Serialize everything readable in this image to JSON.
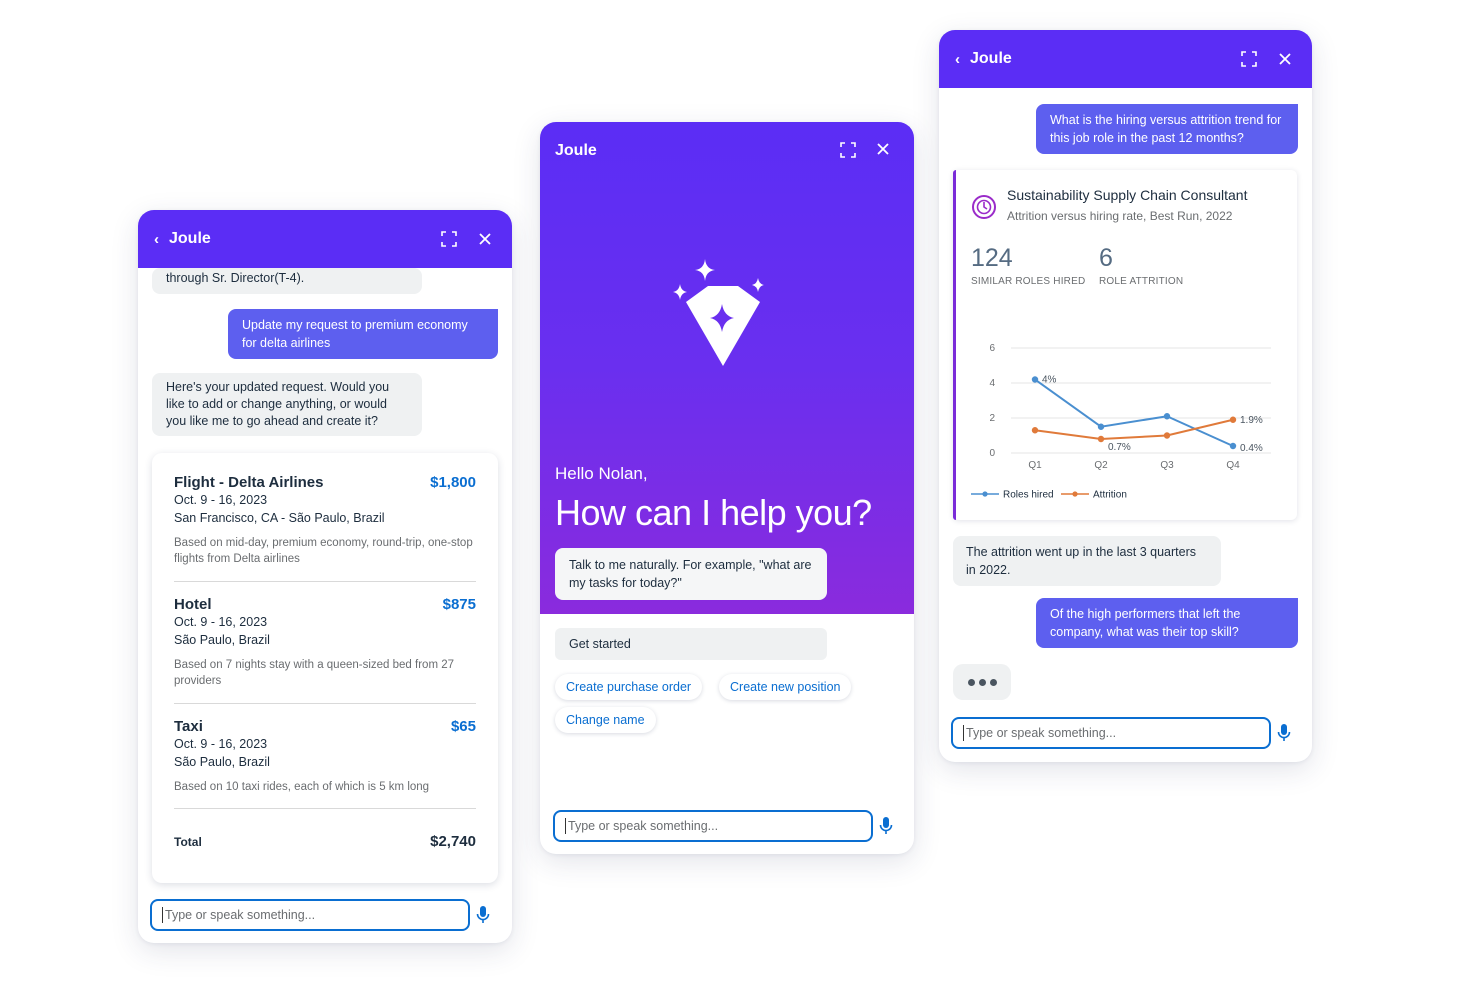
{
  "p1": {
    "title": "Joule",
    "msg_partial": "through Sr. Director(T-4).",
    "user_msg": "Update my request to premium economy for delta airlines",
    "bot_msg": "Here's your updated request. Would you like to add or change anything, or would you like me to go ahead and create it?",
    "items": [
      {
        "name": "Flight - Delta Airlines",
        "price": "$1,800",
        "dates": "Oct. 9 - 16, 2023",
        "place": "San Francisco, CA - São Paulo, Brazil",
        "note": "Based on mid-day, premium economy, round-trip, one-stop flights from Delta airlines"
      },
      {
        "name": "Hotel",
        "price": "$875",
        "dates": "Oct. 9 - 16, 2023",
        "place": "São Paulo, Brazil",
        "note": "Based on 7 nights stay with a queen-sized bed from 27 providers"
      },
      {
        "name": "Taxi",
        "price": "$65",
        "dates": "Oct. 9 - 16, 2023",
        "place": "São Paulo, Brazil",
        "note": "Based on 10 taxi rides, each of which is 5 km long"
      }
    ],
    "total_label": "Total",
    "total_value": "$2,740",
    "input_placeholder": "Type or speak something..."
  },
  "p2": {
    "title": "Joule",
    "hello": "Hello Nolan,",
    "headline": "How can I help you?",
    "prompt": "Talk to me naturally. For example, \"what are my tasks for today?\"",
    "get_started": "Get started",
    "chips": [
      "Create purchase order",
      "Create new position",
      "Change name"
    ],
    "input_placeholder": "Type or speak something..."
  },
  "p3": {
    "title": "Joule",
    "user_msg1": "What is the hiring versus attrition trend for this job role in the past 12 months?",
    "card_title": "Sustainability Supply Chain Consultant",
    "card_subtitle": "Attrition versus hiring rate, Best Run, 2022",
    "kpi1_value": "124",
    "kpi1_label": "SIMILAR ROLES HIRED",
    "kpi2_value": "6",
    "kpi2_label": "ROLE ATTRITION",
    "bot_msg": "The attrition went up in the last 3 quarters in 2022.",
    "user_msg2": "Of the high performers that left the company, what was their top skill?",
    "input_placeholder": "Type or speak something..."
  },
  "colors": {
    "brand": "#5b2df5",
    "accent_link": "#0a6ed1",
    "roles_hired": "#4a8fd0",
    "attrition": "#e07a3a"
  },
  "chart_data": {
    "type": "line",
    "categories": [
      "Q1",
      "Q2",
      "Q3",
      "Q4"
    ],
    "ylim": [
      0,
      6
    ],
    "yticks": [
      0,
      2,
      4,
      6
    ],
    "series": [
      {
        "name": "Roles hired",
        "values": [
          4.2,
          1.5,
          2.1,
          0.4
        ],
        "labels": [
          "4%",
          "",
          "",
          "0.4%"
        ]
      },
      {
        "name": "Attrition",
        "values": [
          1.3,
          0.8,
          1.0,
          1.9
        ],
        "labels": [
          "",
          "0.7%",
          "",
          "1.9%"
        ]
      }
    ],
    "legend_position": "bottom-left"
  }
}
